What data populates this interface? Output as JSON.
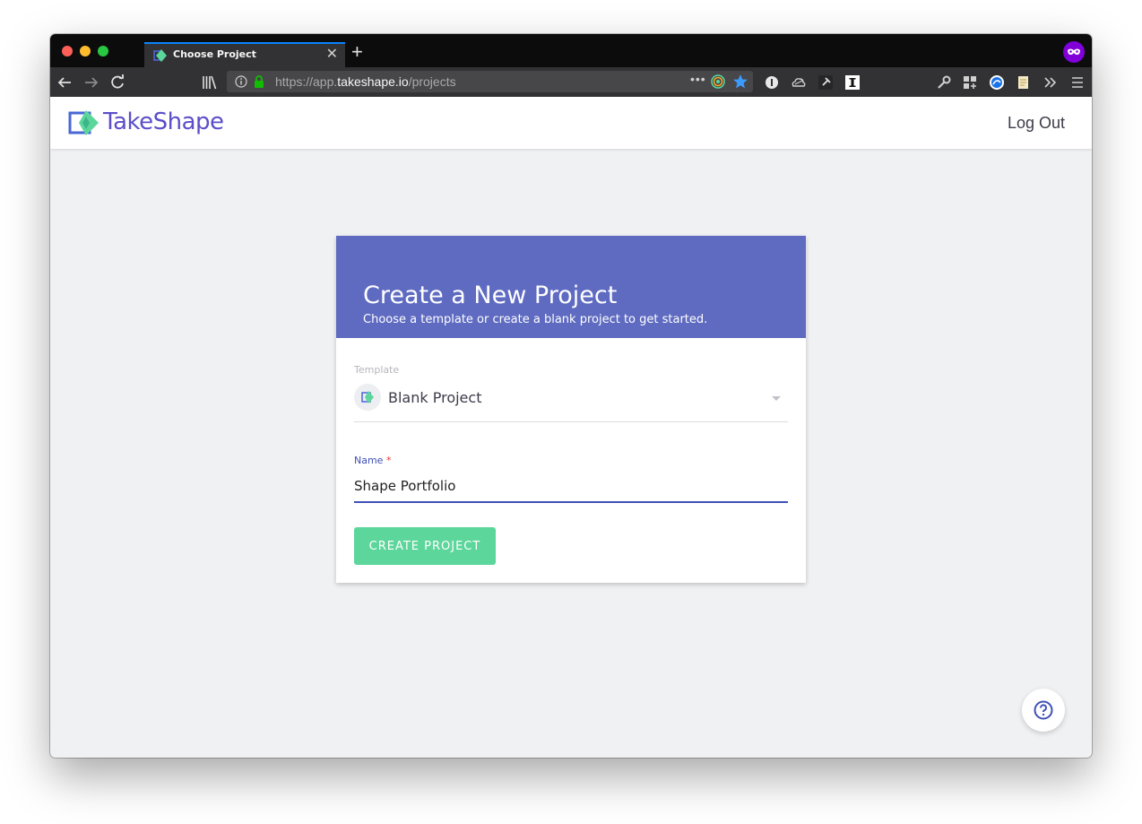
{
  "browser": {
    "tab_title": "Choose Project",
    "tab_close": "✕",
    "new_tab": "+",
    "url_scheme": "https://app.",
    "url_host": "takeshape.io",
    "url_path": "/projects",
    "url_more": "•••"
  },
  "header": {
    "logo_text": "TakeShape",
    "logout_label": "Log Out"
  },
  "card": {
    "title": "Create a New Project",
    "subtitle": "Choose a template or create a blank project to get started.",
    "template_label": "Template",
    "template_value": "Blank Project",
    "name_label": "Name",
    "name_required": " *",
    "name_value": "Shape Portfolio",
    "create_label": "CREATE PROJECT"
  },
  "colors": {
    "brand": "#5b4ec9",
    "card_header": "#5e6bc1",
    "accent": "#3f51b5",
    "button": "#5cd69a"
  },
  "icons": {
    "help": "help-circle-icon",
    "dropdown": "caret-down-icon"
  }
}
